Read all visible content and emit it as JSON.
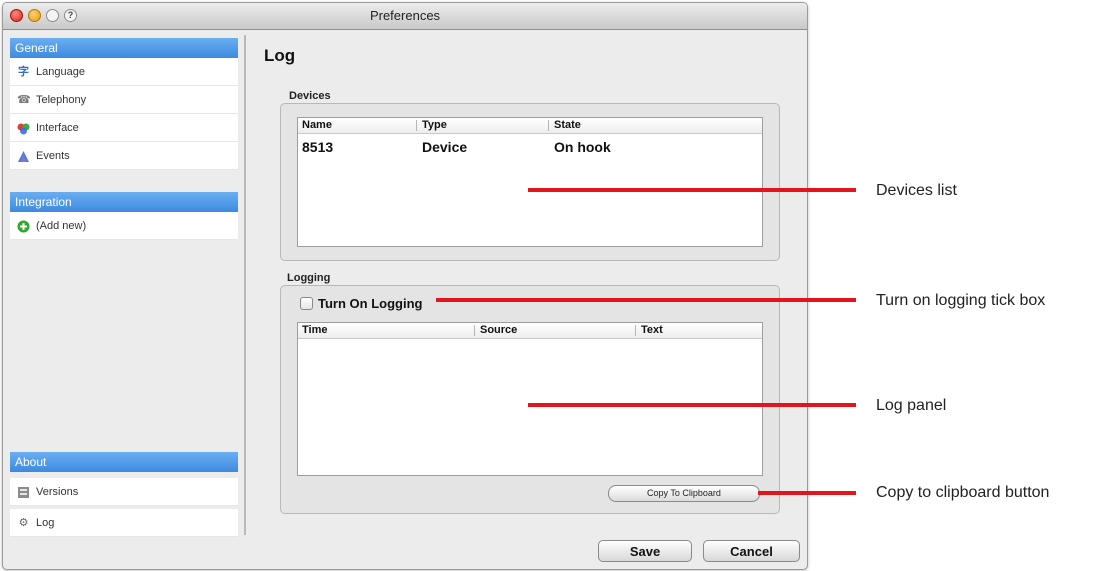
{
  "window": {
    "title": "Preferences"
  },
  "titlebar": {
    "help_glyph": "?"
  },
  "sidebar": {
    "sections": [
      {
        "header": "General",
        "items": [
          {
            "label": "Language",
            "icon": "language-icon"
          },
          {
            "label": "Telephony",
            "icon": "telephony-icon"
          },
          {
            "label": "Interface",
            "icon": "interface-icon"
          },
          {
            "label": "Events",
            "icon": "events-icon"
          }
        ]
      },
      {
        "header": "Integration",
        "items": [
          {
            "label": "(Add new)",
            "icon": "add-icon"
          }
        ]
      },
      {
        "header": "About",
        "items": [
          {
            "label": "Versions",
            "icon": "versions-icon"
          },
          {
            "label": "Log",
            "icon": "log-icon"
          }
        ]
      }
    ]
  },
  "main": {
    "title": "Log",
    "devices": {
      "label": "Devices",
      "columns": [
        "Name",
        "Type",
        "State"
      ],
      "rows": [
        [
          "8513",
          "Device",
          "On hook"
        ]
      ]
    },
    "logging": {
      "label": "Logging",
      "checkbox_label": "Turn On Logging",
      "checkbox_checked": false,
      "columns": [
        "Time",
        "Source",
        "Text"
      ],
      "copy_button": "Copy To Clipboard"
    }
  },
  "footer": {
    "save": "Save",
    "cancel": "Cancel"
  },
  "annotations": [
    "Devices list",
    "Turn on logging tick box",
    "Log panel",
    "Copy to clipboard button"
  ],
  "colors": {
    "accent": "#3d8ae0",
    "callout": "#e3141c"
  }
}
